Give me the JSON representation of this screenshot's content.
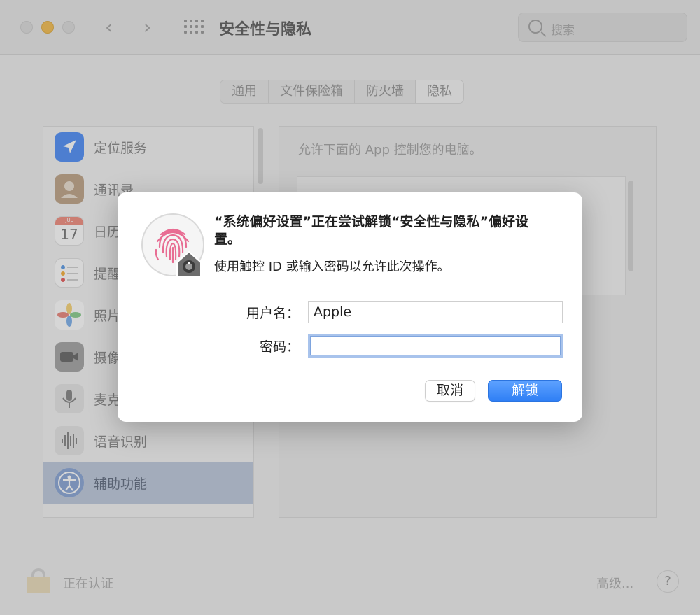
{
  "window": {
    "title": "安全性与隐私",
    "search_placeholder": "搜索"
  },
  "tabs": [
    {
      "label": "通用"
    },
    {
      "label": "文件保险箱"
    },
    {
      "label": "防火墙"
    },
    {
      "label": "隐私",
      "active": true
    }
  ],
  "sidebar": {
    "items": [
      {
        "label": "定位服务",
        "icon": "location-arrow-icon",
        "color": "#3b82f6"
      },
      {
        "label": "通讯录",
        "icon": "contacts-icon",
        "color": "#b89a7a"
      },
      {
        "label": "日历",
        "icon": "calendar-icon",
        "color": "#ffffff",
        "date": "17",
        "month": "JUL"
      },
      {
        "label": "提醒",
        "icon": "reminders-icon",
        "color": "#ffffff"
      },
      {
        "label": "照片",
        "icon": "photos-icon",
        "color": "#ffffff"
      },
      {
        "label": "摄像",
        "icon": "camera-icon",
        "color": "#555555"
      },
      {
        "label": "麦克",
        "icon": "microphone-icon",
        "color": "#777777"
      },
      {
        "label": "语音识别",
        "icon": "waveform-icon",
        "color": "#777777"
      },
      {
        "label": "辅助功能",
        "icon": "accessibility-icon",
        "color": "#2e6ce0",
        "selected": true
      }
    ]
  },
  "content": {
    "description": "允许下面的 App 控制您的电脑。"
  },
  "footer": {
    "lock_text": "正在认证",
    "advanced_label": "高级...",
    "help_label": "?"
  },
  "dialog": {
    "title": "“系统偏好设置”正在尝试解锁“安全性与隐私”偏好设置。",
    "subtitle": "使用触控 ID 或输入密码以允许此次操作。",
    "username_label": "用户名：",
    "username_value": "Apple",
    "password_label": "密码：",
    "password_value": "",
    "cancel_label": "取消",
    "unlock_label": "解锁",
    "accent_color": "#2f7ff5",
    "fingerprint_color": "#e86d93"
  }
}
